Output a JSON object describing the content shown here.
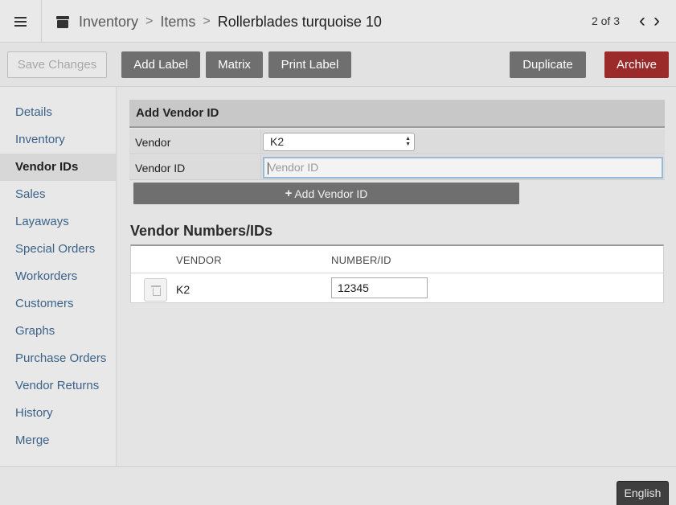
{
  "header": {
    "breadcrumb": [
      "Inventory",
      "Items"
    ],
    "current": "Rollerblades turquoise 10",
    "pager_text": "2 of 3",
    "prev_glyph": "‹",
    "next_glyph": "›"
  },
  "toolbar": {
    "save_label": "Save Changes",
    "add_label": "Add Label",
    "matrix": "Matrix",
    "print_label": "Print Label",
    "duplicate": "Duplicate",
    "archive": "Archive"
  },
  "sidebar": {
    "items": [
      {
        "label": "Details"
      },
      {
        "label": "Inventory"
      },
      {
        "label": "Vendor IDs"
      },
      {
        "label": "Sales"
      },
      {
        "label": "Layaways"
      },
      {
        "label": "Special Orders"
      },
      {
        "label": "Workorders"
      },
      {
        "label": "Customers"
      },
      {
        "label": "Graphs"
      },
      {
        "label": "Purchase Orders"
      },
      {
        "label": "Vendor Returns"
      },
      {
        "label": "History"
      },
      {
        "label": "Merge"
      }
    ],
    "active_index": 2
  },
  "add_vendor": {
    "heading": "Add Vendor ID",
    "vendor_label": "Vendor",
    "vendor_value": "K2",
    "vendor_id_label": "Vendor ID",
    "vendor_id_placeholder": "Vendor ID",
    "add_button": "Add Vendor ID"
  },
  "vendor_numbers": {
    "title": "Vendor Numbers/IDs",
    "columns": [
      "VENDOR",
      "NUMBER/ID"
    ],
    "rows": [
      {
        "vendor": "K2",
        "number": "12345"
      }
    ]
  },
  "footer": {
    "language": "English"
  },
  "colors": {
    "archive": "#9b2b2b",
    "button": "#6f6f6f",
    "link": "#3b6288"
  }
}
